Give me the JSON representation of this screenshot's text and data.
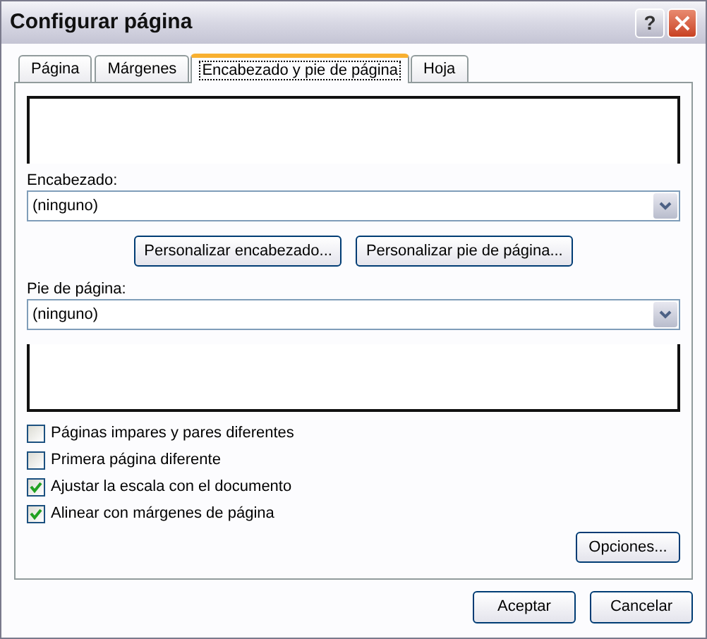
{
  "window": {
    "title": "Configurar página",
    "help_button": "?"
  },
  "tabs": [
    {
      "label": "Página",
      "selected": false
    },
    {
      "label": "Márgenes",
      "selected": false
    },
    {
      "label": "Encabezado y pie de página",
      "selected": true
    },
    {
      "label": "Hoja",
      "selected": false
    }
  ],
  "header": {
    "label": "Encabezado:",
    "value": "(ninguno)"
  },
  "custom_buttons": [
    "Personalizar encabezado...",
    "Personalizar pie de página..."
  ],
  "footer": {
    "label": "Pie de página:",
    "value": "(ninguno)"
  },
  "options": [
    {
      "label": "Páginas impares y pares diferentes",
      "checked": false
    },
    {
      "label": "Primera página diferente",
      "checked": false
    },
    {
      "label": "Ajustar la escala con el documento",
      "checked": true
    },
    {
      "label": "Alinear con márgenes de página",
      "checked": true
    }
  ],
  "options_button": "Opciones...",
  "buttons": [
    "Aceptar",
    "Cancelar"
  ]
}
